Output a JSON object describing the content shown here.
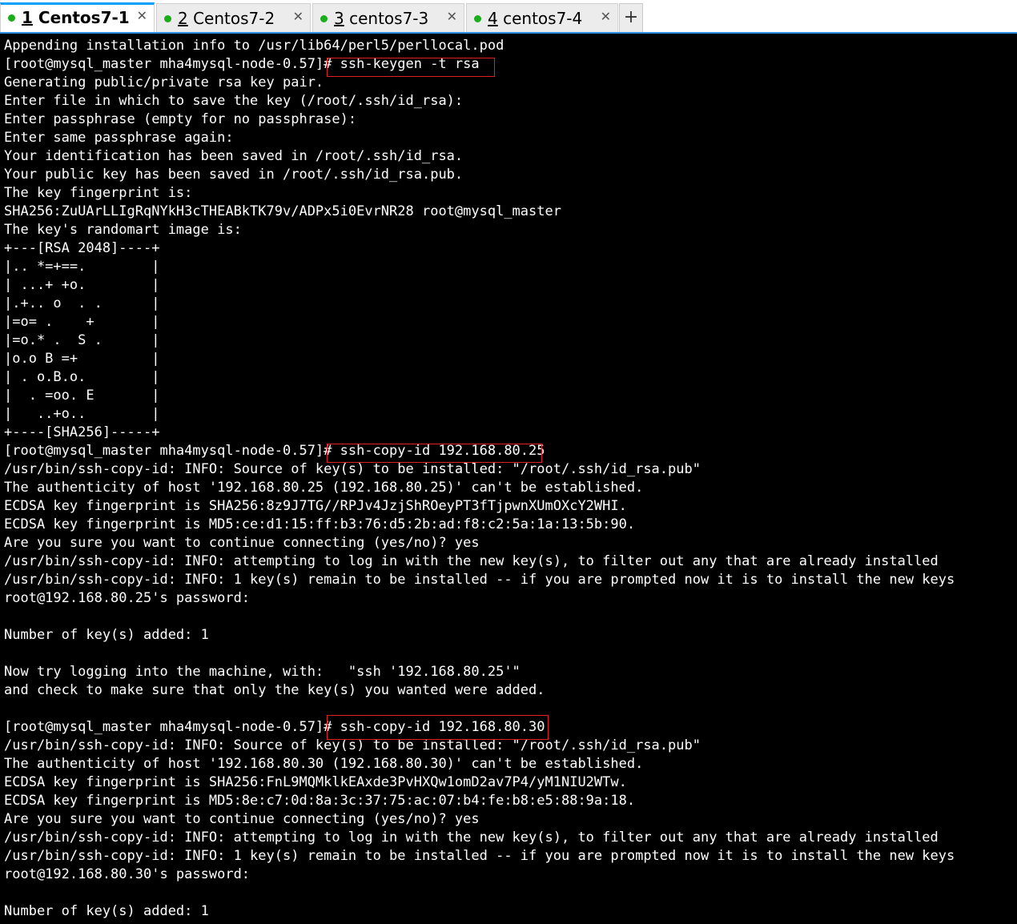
{
  "tabs": [
    {
      "num": "1",
      "label": " Centos7-1",
      "active": true,
      "close": "✕"
    },
    {
      "num": "2",
      "label": " Centos7-2",
      "active": false,
      "close": "✕"
    },
    {
      "num": "3",
      "label": " centos7-3",
      "active": false,
      "close": "✕"
    },
    {
      "num": "4",
      "label": " centos7-4",
      "active": false,
      "close": "✕"
    }
  ],
  "new_tab_label": "+",
  "terminal": {
    "lines": [
      "Appending installation info to /usr/lib64/perl5/perllocal.pod",
      "[root@mysql_master mha4mysql-node-0.57]# ssh-keygen -t rsa",
      "Generating public/private rsa key pair.",
      "Enter file in which to save the key (/root/.ssh/id_rsa):",
      "Enter passphrase (empty for no passphrase):",
      "Enter same passphrase again:",
      "Your identification has been saved in /root/.ssh/id_rsa.",
      "Your public key has been saved in /root/.ssh/id_rsa.pub.",
      "The key fingerprint is:",
      "SHA256:ZuUArLLIgRqNYkH3cTHEABkTK79v/ADPx5i0EvrNR28 root@mysql_master",
      "The key's randomart image is:",
      "+---[RSA 2048]----+",
      "|.. *=+==.        |",
      "| ...+ +o.        |",
      "|.+.. o  . .      |",
      "|=o= .    +       |",
      "|=o.* .  S .      |",
      "|o.o B =+         |",
      "| . o.B.o.        |",
      "|  . =oo. E       |",
      "|   ..+o..        |",
      "+----[SHA256]-----+",
      "[root@mysql_master mha4mysql-node-0.57]# ssh-copy-id 192.168.80.25",
      "/usr/bin/ssh-copy-id: INFO: Source of key(s) to be installed: \"/root/.ssh/id_rsa.pub\"",
      "The authenticity of host '192.168.80.25 (192.168.80.25)' can't be established.",
      "ECDSA key fingerprint is SHA256:8z9J7TG//RPJv4JzjShROeyPT3fTjpwnXUmOXcY2WHI.",
      "ECDSA key fingerprint is MD5:ce:d1:15:ff:b3:76:d5:2b:ad:f8:c2:5a:1a:13:5b:90.",
      "Are you sure you want to continue connecting (yes/no)? yes",
      "/usr/bin/ssh-copy-id: INFO: attempting to log in with the new key(s), to filter out any that are already installed",
      "/usr/bin/ssh-copy-id: INFO: 1 key(s) remain to be installed -- if you are prompted now it is to install the new keys",
      "root@192.168.80.25's password: ",
      "",
      "Number of key(s) added: 1",
      "",
      "Now try logging into the machine, with:   \"ssh '192.168.80.25'\"",
      "and check to make sure that only the key(s) you wanted were added.",
      "",
      "[root@mysql_master mha4mysql-node-0.57]# ssh-copy-id 192.168.80.30",
      "/usr/bin/ssh-copy-id: INFO: Source of key(s) to be installed: \"/root/.ssh/id_rsa.pub\"",
      "The authenticity of host '192.168.80.30 (192.168.80.30)' can't be established.",
      "ECDSA key fingerprint is SHA256:FnL9MQMklkEAxde3PvHXQw1omD2av7P4/yM1NIU2WTw.",
      "ECDSA key fingerprint is MD5:8e:c7:0d:8a:3c:37:75:ac:07:b4:fe:b8:e5:88:9a:18.",
      "Are you sure you want to continue connecting (yes/no)? yes",
      "/usr/bin/ssh-copy-id: INFO: attempting to log in with the new key(s), to filter out any that are already installed",
      "/usr/bin/ssh-copy-id: INFO: 1 key(s) remain to be installed -- if you are prompted now it is to install the new keys",
      "root@192.168.80.30's password: ",
      "",
      "Number of key(s) added: 1"
    ]
  },
  "colors": {
    "terminal_bg": "#000000",
    "terminal_fg": "#ffffff",
    "highlight_box": "#e02020",
    "tab_active_accent": "#00a0ff",
    "status_dot": "#1aae1a"
  }
}
